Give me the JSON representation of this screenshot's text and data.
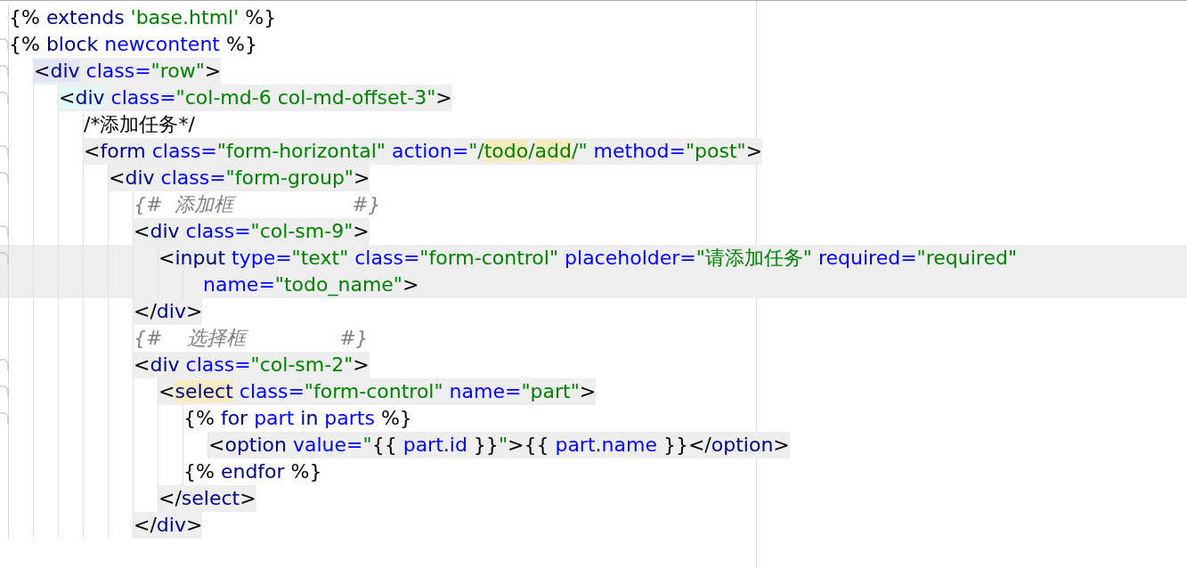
{
  "editor": {
    "lines": [
      {
        "shaded": false,
        "current": false,
        "tokens": [
          {
            "kind": "punct",
            "text": "{% "
          },
          {
            "kind": "keyword",
            "text": "extends"
          },
          {
            "kind": "string",
            "text": " 'base.html'"
          },
          {
            "kind": "punct",
            "text": " %}"
          }
        ]
      },
      {
        "shaded": false,
        "current": false,
        "tokens": [
          {
            "kind": "punct",
            "text": "{% "
          },
          {
            "kind": "keyword",
            "text": "block"
          },
          {
            "kind": "attr",
            "text": " newcontent"
          },
          {
            "kind": "punct",
            "text": " %}"
          }
        ],
        "children": [
          {
            "shaded": true,
            "current": false,
            "tokens": [
              {
                "kind": "punct",
                "text": "<",
                "color": "#e4e4f8"
              },
              {
                "kind": "keyword",
                "text": "div",
                "color": "#e4e4f8"
              },
              {
                "kind": "attr",
                "text": " class="
              },
              {
                "kind": "string",
                "text": "\"row\""
              },
              {
                "kind": "punct",
                "text": ">"
              }
            ],
            "children": [
              {
                "shaded": true,
                "current": false,
                "tokens": [
                  {
                    "kind": "punct",
                    "text": "<",
                    "color": "#e2fafa"
                  },
                  {
                    "kind": "keyword",
                    "text": "div",
                    "color": "#e2fafa"
                  },
                  {
                    "kind": "attr",
                    "text": " class="
                  },
                  {
                    "kind": "string",
                    "text": "\"col-md-6 col-md-offset-3\""
                  },
                  {
                    "kind": "punct",
                    "text": ">"
                  }
                ],
                "children": [
                  {
                    "shaded": false,
                    "current": false,
                    "tokens": [
                      {
                        "kind": "punct",
                        "text": "/*添加任务*/"
                      }
                    ]
                  },
                  {
                    "shaded": true,
                    "current": false,
                    "tokens": [
                      {
                        "kind": "punct",
                        "text": "<"
                      },
                      {
                        "kind": "keyword",
                        "text": "form"
                      },
                      {
                        "kind": "attr",
                        "text": " class="
                      },
                      {
                        "kind": "string",
                        "text": "\"form-horizontal\""
                      },
                      {
                        "kind": "attr",
                        "text": " action="
                      },
                      {
                        "kind": "string",
                        "text": "\"/"
                      },
                      {
                        "kind": "string",
                        "text": "todo",
                        "color": "#f7ebc0"
                      },
                      {
                        "kind": "string",
                        "text": "/"
                      },
                      {
                        "kind": "string",
                        "text": "add",
                        "color": "#f7ebc0"
                      },
                      {
                        "kind": "string",
                        "text": "/\""
                      },
                      {
                        "kind": "attr",
                        "text": " method="
                      },
                      {
                        "kind": "string",
                        "text": "\"post\""
                      },
                      {
                        "kind": "punct",
                        "text": ">"
                      }
                    ],
                    "children": [
                      {
                        "shaded": true,
                        "current": false,
                        "tokens": [
                          {
                            "kind": "punct",
                            "text": "<"
                          },
                          {
                            "kind": "keyword",
                            "text": "div"
                          },
                          {
                            "kind": "attr",
                            "text": " class="
                          },
                          {
                            "kind": "string",
                            "text": "\"form-group\""
                          },
                          {
                            "kind": "punct",
                            "text": ">"
                          }
                        ],
                        "children": [
                          {
                            "shaded": false,
                            "current": false,
                            "tokens": [
                              {
                                "kind": "comment",
                                "text": "{#  添加框                   #}"
                              }
                            ]
                          },
                          {
                            "shaded": true,
                            "current": false,
                            "tokens": [
                              {
                                "kind": "punct",
                                "text": "<"
                              },
                              {
                                "kind": "keyword",
                                "text": "div"
                              },
                              {
                                "kind": "attr",
                                "text": " class="
                              },
                              {
                                "kind": "string",
                                "text": "\"col-sm-9\""
                              },
                              {
                                "kind": "punct",
                                "text": ">"
                              }
                            ],
                            "children": [
                              {
                                "shaded": false,
                                "current": true,
                                "tokens": [
                                  {
                                    "kind": "punct",
                                    "text": "<"
                                  },
                                  {
                                    "kind": "keyword",
                                    "text": "input"
                                  },
                                  {
                                    "kind": "attr",
                                    "text": " type="
                                  },
                                  {
                                    "kind": "string",
                                    "text": "\"text\""
                                  },
                                  {
                                    "kind": "attr",
                                    "text": " class="
                                  },
                                  {
                                    "kind": "string",
                                    "text": "\"form-control\""
                                  },
                                  {
                                    "kind": "attr",
                                    "text": " placeholder="
                                  },
                                  {
                                    "kind": "string",
                                    "text": "\"请添加任务\""
                                  },
                                  {
                                    "kind": "attr",
                                    "text": " required="
                                  },
                                  {
                                    "kind": "string",
                                    "text": "\"required\""
                                  }
                                ],
                                "children": [
                                  {
                                    "kind": "wrap",
                                    "shaded": false,
                                    "current": true,
                                    "tokens": [
                                      {
                                        "kind": "attr",
                                        "text": "name="
                                      },
                                      {
                                        "kind": "string",
                                        "text": "\"todo_name\""
                                      },
                                      {
                                        "kind": "punct",
                                        "text": ">"
                                      }
                                    ]
                                  }
                                ]
                              }
                            ]
                          },
                          {
                            "shaded": true,
                            "current": false,
                            "tokens": [
                              {
                                "kind": "punct",
                                "text": "</"
                              },
                              {
                                "kind": "keyword",
                                "text": "div"
                              },
                              {
                                "kind": "punct",
                                "text": ">"
                              }
                            ]
                          },
                          {
                            "shaded": false,
                            "current": false,
                            "tokens": [
                              {
                                "kind": "comment",
                                "text": "{#    选择框               #}"
                              }
                            ]
                          },
                          {
                            "shaded": true,
                            "current": false,
                            "tokens": [
                              {
                                "kind": "punct",
                                "text": "<"
                              },
                              {
                                "kind": "keyword",
                                "text": "div"
                              },
                              {
                                "kind": "attr",
                                "text": " class="
                              },
                              {
                                "kind": "string",
                                "text": "\"col-sm-2\""
                              },
                              {
                                "kind": "punct",
                                "text": ">"
                              }
                            ],
                            "children": [
                              {
                                "shaded": true,
                                "current": false,
                                "tokens": [
                                  {
                                    "kind": "punct",
                                    "text": "<"
                                  },
                                  {
                                    "kind": "keyword",
                                    "text": "select",
                                    "color": "#f7ebc0"
                                  },
                                  {
                                    "kind": "attr",
                                    "text": " class="
                                  },
                                  {
                                    "kind": "string",
                                    "text": "\"form-control\""
                                  },
                                  {
                                    "kind": "attr",
                                    "text": " name="
                                  },
                                  {
                                    "kind": "string",
                                    "text": "\"part\""
                                  },
                                  {
                                    "kind": "punct",
                                    "text": ">"
                                  }
                                ],
                                "children": [
                                  {
                                    "shaded": false,
                                    "current": false,
                                    "tokens": [
                                      {
                                        "kind": "punct",
                                        "text": "{% "
                                      },
                                      {
                                        "kind": "keyword",
                                        "text": "for"
                                      },
                                      {
                                        "kind": "attr",
                                        "text": " part"
                                      },
                                      {
                                        "kind": "keyword",
                                        "text": " in"
                                      },
                                      {
                                        "kind": "attr",
                                        "text": " parts"
                                      },
                                      {
                                        "kind": "punct",
                                        "text": " %}"
                                      }
                                    ],
                                    "children": [
                                      {
                                        "shaded": true,
                                        "current": false,
                                        "tokens": [
                                          {
                                            "kind": "punct",
                                            "text": "<"
                                          },
                                          {
                                            "kind": "keyword",
                                            "text": "option"
                                          },
                                          {
                                            "kind": "attr",
                                            "text": " value="
                                          },
                                          {
                                            "kind": "string",
                                            "text": "\""
                                          },
                                          {
                                            "kind": "punct",
                                            "text": "{{ "
                                          },
                                          {
                                            "kind": "attr",
                                            "text": "part"
                                          },
                                          {
                                            "kind": "punct",
                                            "text": "."
                                          },
                                          {
                                            "kind": "attr",
                                            "text": "id"
                                          },
                                          {
                                            "kind": "punct",
                                            "text": " }}"
                                          },
                                          {
                                            "kind": "string",
                                            "text": "\""
                                          },
                                          {
                                            "kind": "punct",
                                            "text": ">{{ "
                                          },
                                          {
                                            "kind": "attr",
                                            "text": "part"
                                          },
                                          {
                                            "kind": "punct",
                                            "text": "."
                                          },
                                          {
                                            "kind": "attr",
                                            "text": "name"
                                          },
                                          {
                                            "kind": "punct",
                                            "text": " }}</"
                                          },
                                          {
                                            "kind": "keyword",
                                            "text": "option"
                                          },
                                          {
                                            "kind": "punct",
                                            "text": ">"
                                          }
                                        ]
                                      }
                                    ]
                                  },
                                  {
                                    "shaded": false,
                                    "current": false,
                                    "tokens": [
                                      {
                                        "kind": "punct",
                                        "text": "{% "
                                      },
                                      {
                                        "kind": "keyword",
                                        "text": "endfor"
                                      },
                                      {
                                        "kind": "punct",
                                        "text": " %}"
                                      }
                                    ]
                                  }
                                ]
                              },
                              {
                                "shaded": true,
                                "current": false,
                                "tokens": [
                                  {
                                    "kind": "punct",
                                    "text": "</"
                                  },
                                  {
                                    "kind": "keyword",
                                    "text": "select"
                                  },
                                  {
                                    "kind": "punct",
                                    "text": ">"
                                  }
                                ]
                              }
                            ]
                          },
                          {
                            "shaded": true,
                            "current": false,
                            "tokens": [
                              {
                                "kind": "punct",
                                "text": "</"
                              },
                              {
                                "kind": "keyword",
                                "text": "div"
                              },
                              {
                                "kind": "punct",
                                "text": ">"
                              }
                            ]
                          }
                        ]
                      }
                    ]
                  }
                ]
              }
            ]
          }
        ]
      }
    ]
  }
}
